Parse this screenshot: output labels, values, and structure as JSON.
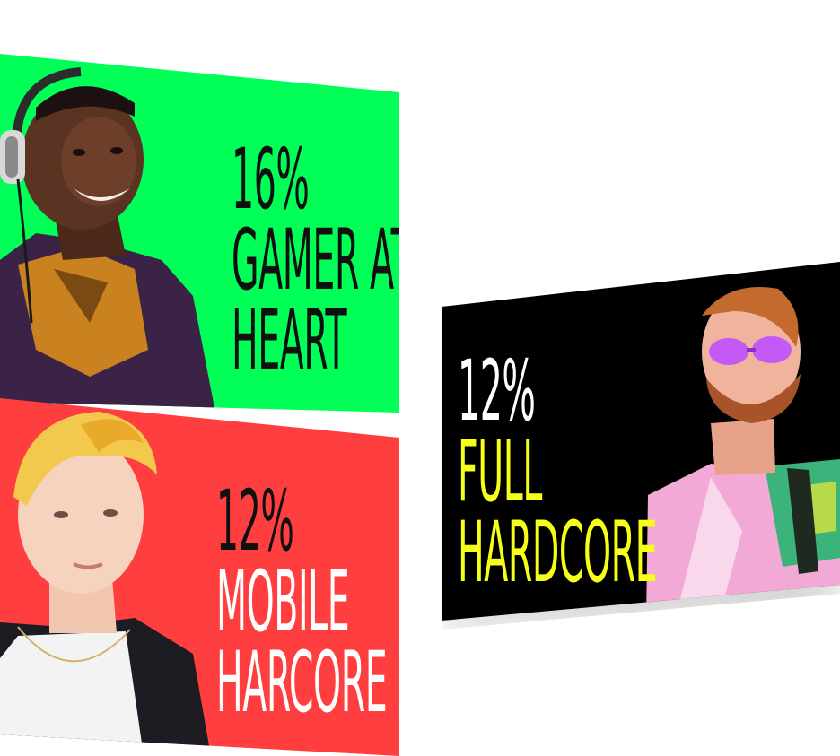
{
  "cards": [
    {
      "name": "green",
      "accent": "#00ff57",
      "text_color": "#101010",
      "percent": "16%",
      "label_line1": "GAMER AT",
      "label_line2": "HEART",
      "portrait": "headphones-man-illustration"
    },
    {
      "name": "red",
      "accent": "#ff3f3f",
      "percent": "12%",
      "label_line1": "MOBILE",
      "label_line2": "HARCORE",
      "portrait": "blonde-person-illustration"
    },
    {
      "name": "black",
      "accent": "#000000",
      "percent": "12%",
      "label_line1": "FULL",
      "label_line2": "HARDCORE",
      "label_color": "#f5ff17",
      "portrait": "sunglasses-man-illustration"
    }
  ]
}
